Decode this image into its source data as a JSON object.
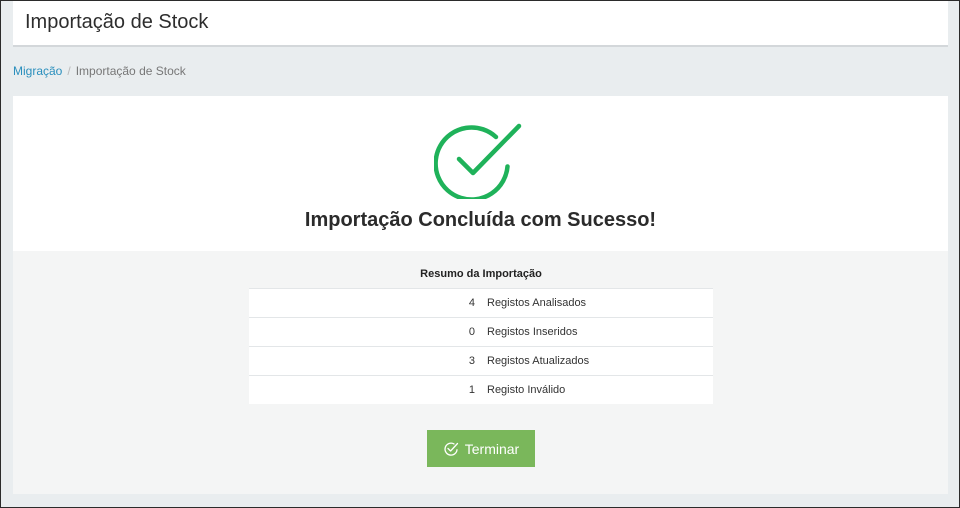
{
  "header": {
    "title": "Importação de Stock"
  },
  "breadcrumb": {
    "parent": "Migração",
    "separator": "/",
    "current": "Importação de Stock"
  },
  "result": {
    "title": "Importação Concluída com Sucesso!",
    "icon": "check-circle-icon",
    "icon_color": "#1fb25a"
  },
  "summary": {
    "heading": "Resumo da Importação",
    "rows": [
      {
        "count": "4",
        "label": "Registos Analisados"
      },
      {
        "count": "0",
        "label": "Registos Inseridos"
      },
      {
        "count": "3",
        "label": "Registos Atualizados"
      },
      {
        "count": "1",
        "label": "Registo Inválido"
      }
    ]
  },
  "actions": {
    "finish_label": "Terminar",
    "finish_icon": "check-circle-icon",
    "finish_color": "#7ab75b"
  }
}
